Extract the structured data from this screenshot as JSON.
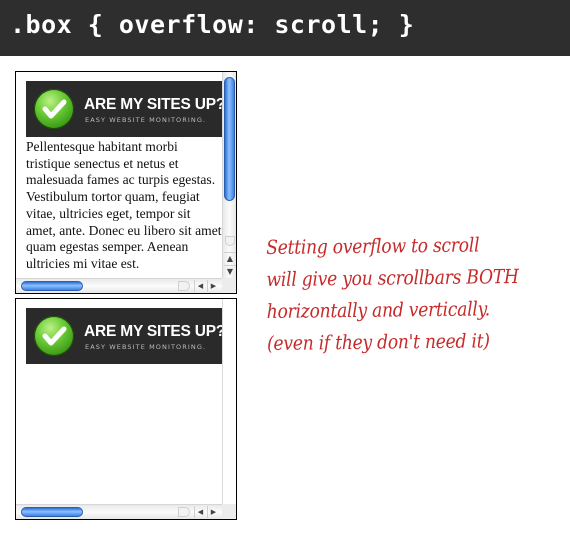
{
  "header": {
    "code": ".box { overflow: scroll; }"
  },
  "banner": {
    "title": "ARE MY SITES UP?",
    "subtitle": "EASY WEBSITE MONITORING."
  },
  "box_top": {
    "text": "Pellentesque habitant morbi tristique senectus et netus et malesuada fames ac turpis egestas. Vestibulum tortor quam, feugiat vitae, ultricies eget, tempor sit amet, ante. Donec eu libero sit amet quam egestas semper. Aenean ultricies mi vitae est."
  },
  "note": {
    "lines": [
      "Setting overflow to scroll",
      "will give you scrollbars BOTH",
      "horizontally and vertically.",
      "(even if they don't need it)"
    ]
  },
  "icons": {
    "check": "check-icon",
    "up_arrow": "up-arrow-icon",
    "down_arrow": "down-arrow-icon",
    "left_arrow": "left-arrow-icon",
    "right_arrow": "right-arrow-icon"
  },
  "colors": {
    "header_bg": "#2e2e2e",
    "note_text": "#c62a2a",
    "scroll_thumb": "#3d82e4"
  }
}
